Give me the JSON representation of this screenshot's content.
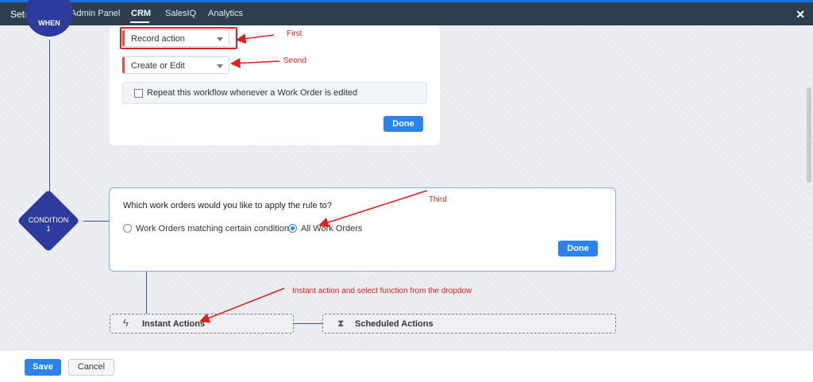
{
  "header": {
    "title": "Setup",
    "tabs": [
      "Admin Panel",
      "CRM",
      "SalesIQ",
      "Analytics"
    ],
    "close_symbol": "✕"
  },
  "when_node": {
    "label": "WHEN"
  },
  "trigger_card": {
    "select1": "Record action",
    "select2": "Create or Edit",
    "repeat_label": "Repeat this workflow whenever a Work Order is edited",
    "done_label": "Done"
  },
  "condition_node": {
    "line1": "CONDITION",
    "line2": "1"
  },
  "condition_card": {
    "question": "Which work orders would you like to apply the rule to?",
    "option1": "Work Orders matching certain conditions",
    "option2": "All Work Orders",
    "selected": "All Work Orders",
    "done_label": "Done"
  },
  "actions": {
    "instant_label": "Instant Actions",
    "scheduled_label": "Scheduled Actions",
    "instant_icon": "lightning-plus-icon",
    "scheduled_icon": "hourglass-plus-icon"
  },
  "annotations": {
    "first": "First",
    "second": "Seond",
    "third": "Third",
    "fourth": "Instant action and select function from the dropdow",
    "color": "#e02020"
  },
  "footer": {
    "save_label": "Save",
    "cancel_label": "Cancel"
  },
  "colors": {
    "primary": "#2a83ef",
    "node": "#2d3b9c",
    "header_bg": "#2c3e50",
    "required_bar": "#e74c3c"
  }
}
